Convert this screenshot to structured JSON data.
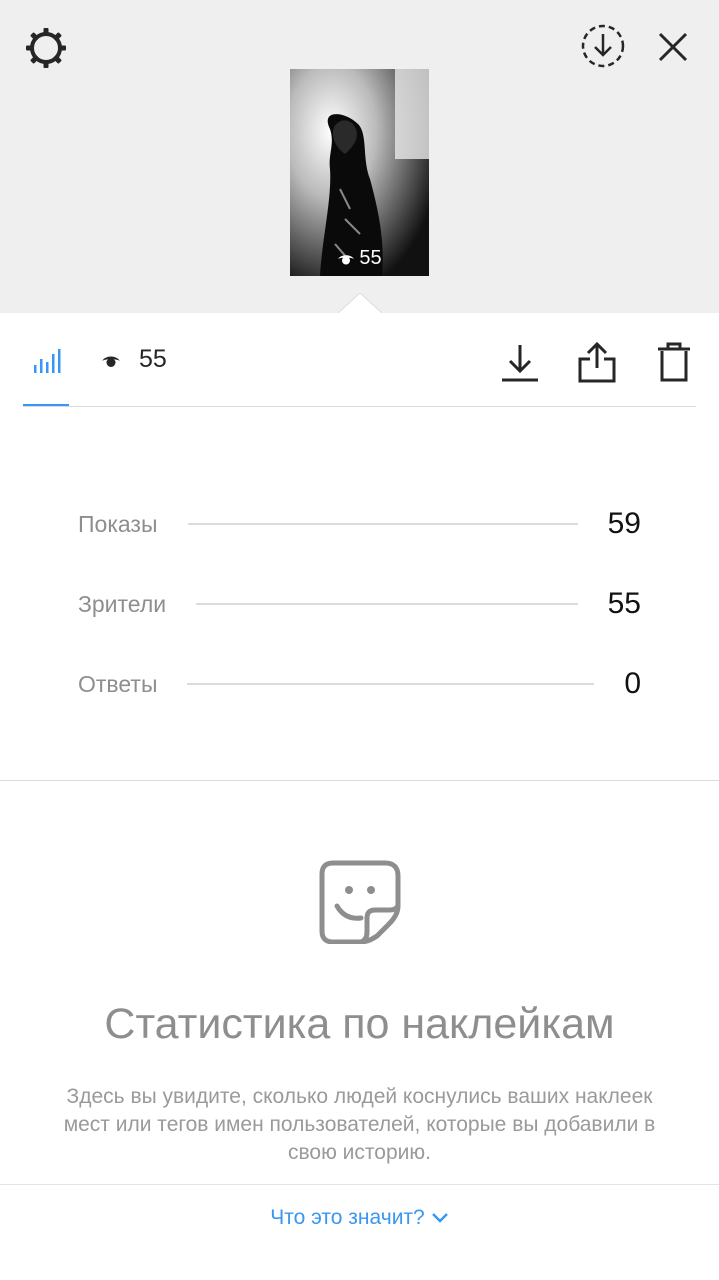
{
  "header": {
    "settings_icon": "gear-icon",
    "download_all_icon": "circle-download-icon",
    "close_icon": "close-icon"
  },
  "story_thumbnail": {
    "views": "55",
    "eye_icon": "eye-icon"
  },
  "tabs": {
    "insights_icon": "bar-chart-icon",
    "viewers_icon": "eye-icon",
    "viewers_count": "55",
    "accent_color": "#3897f0"
  },
  "actions": {
    "download_icon": "download-icon",
    "share_icon": "share-icon",
    "delete_icon": "trash-icon"
  },
  "stats": [
    {
      "label": "Показы",
      "value": "59"
    },
    {
      "label": "Зрители",
      "value": "55"
    },
    {
      "label": "Ответы",
      "value": "0"
    }
  ],
  "sticker_section": {
    "icon": "sticker-icon",
    "title": "Статистика по наклейкам",
    "description": "Здесь вы увидите, сколько людей коснулись ваших наклеек мест или тегов имен пользователей, которые вы добавили в свою историю.",
    "help_link": "Что это значит?"
  }
}
